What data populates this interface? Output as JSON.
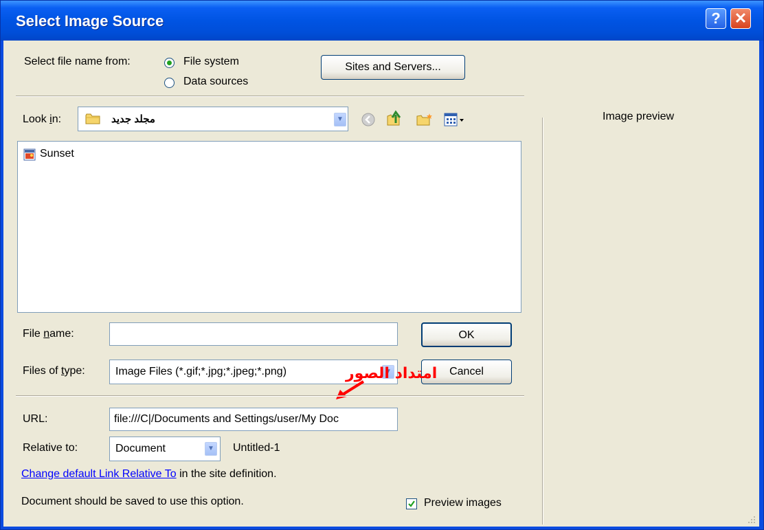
{
  "window": {
    "title": "Select Image Source",
    "help_label": "?",
    "close_label": "✕"
  },
  "source": {
    "label": "Select file name from:",
    "options": [
      {
        "label": "File system",
        "selected": true
      },
      {
        "label": "Data sources",
        "selected": false
      }
    ],
    "sites_button": "Sites and Servers..."
  },
  "lookin": {
    "label_pre": "Look ",
    "label_key": "i",
    "label_post": "n:",
    "folder": "مجلد جديد"
  },
  "toolbar_icons": [
    "back-icon",
    "up-folder-icon",
    "new-folder-icon",
    "view-menu-icon"
  ],
  "files": [
    {
      "name": "Sunset",
      "icon": "image-file-icon"
    }
  ],
  "preview": {
    "label": "Image preview"
  },
  "filename": {
    "label_pre": "File ",
    "label_key": "n",
    "label_post": "ame:",
    "value": ""
  },
  "filetype": {
    "label_pre": "Files of ",
    "label_key": "t",
    "label_post": "ype:",
    "value": "Image Files (*.gif;*.jpg;*.jpeg;*.png)"
  },
  "ok_label": "OK",
  "cancel_label": "Cancel",
  "annotation": {
    "text": "امتداد الصور",
    "color": "#ff0000"
  },
  "url": {
    "label": "URL:",
    "value": "file:///C|/Documents and Settings/user/My Doc"
  },
  "relative": {
    "label": "Relative to:",
    "value": "Document",
    "doc_name": "Untitled-1"
  },
  "change_link": {
    "link": "Change default Link Relative To",
    "rest": " in the site definition."
  },
  "note": "Document should be saved to use this option.",
  "preview_images": {
    "label": "Preview images",
    "checked": true
  }
}
